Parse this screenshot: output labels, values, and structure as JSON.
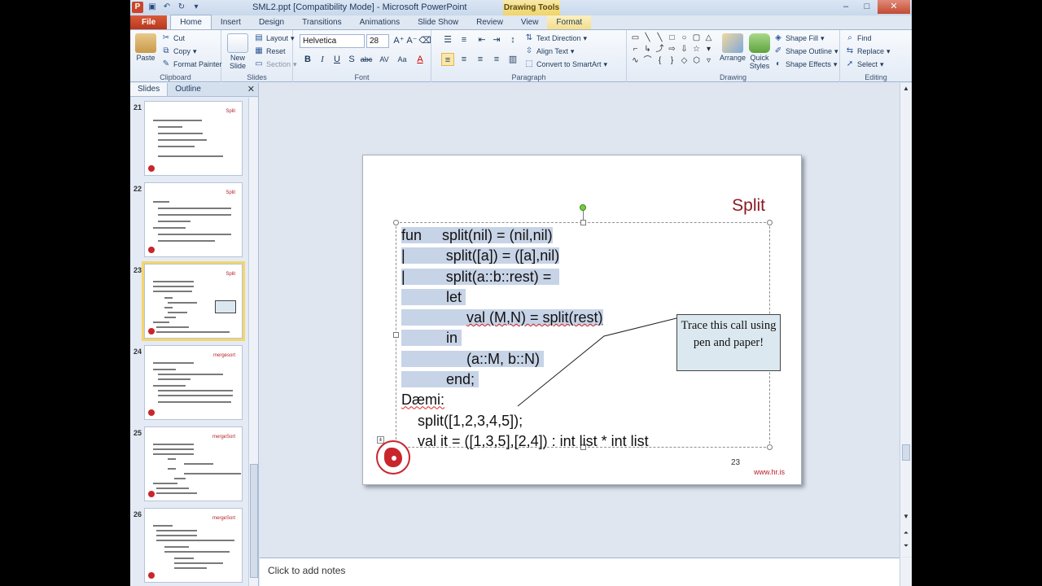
{
  "window": {
    "title": "SML2.ppt [Compatibility Mode] - Microsoft PowerPoint",
    "context_tab_label": "Drawing Tools"
  },
  "tabs": [
    "File",
    "Home",
    "Insert",
    "Design",
    "Transitions",
    "Animations",
    "Slide Show",
    "Review",
    "View",
    "Format"
  ],
  "ribbon": {
    "clipboard": {
      "paste": "Paste",
      "cut": "Cut",
      "copy": "Copy",
      "format_painter": "Format Painter",
      "label": "Clipboard"
    },
    "slides": {
      "new_slide": "New Slide",
      "layout": "Layout",
      "reset": "Reset",
      "section": "Section",
      "label": "Slides"
    },
    "font": {
      "name": "Helvetica",
      "size": "28",
      "label": "Font",
      "bold": "B",
      "italic": "I",
      "underline": "U",
      "strike": "S",
      "shadow": "abc",
      "spacing": "AV",
      "case": "Aa",
      "color": "A"
    },
    "paragraph": {
      "text_direction": "Text Direction",
      "align_text": "Align Text",
      "convert_smartart": "Convert to SmartArt",
      "label": "Paragraph"
    },
    "drawing": {
      "arrange": "Arrange",
      "quick_styles": "Quick Styles",
      "shape_fill": "Shape Fill",
      "shape_outline": "Shape Outline",
      "shape_effects": "Shape Effects",
      "label": "Drawing"
    },
    "editing": {
      "find": "Find",
      "replace": "Replace",
      "select": "Select",
      "label": "Editing"
    }
  },
  "left_panel": {
    "tabs": [
      "Slides",
      "Outline"
    ],
    "thumbnails": [
      {
        "num": "21",
        "title": "Split"
      },
      {
        "num": "22",
        "title": "Split"
      },
      {
        "num": "23",
        "title": "Split"
      },
      {
        "num": "24",
        "title": "mergesort"
      },
      {
        "num": "25",
        "title": "mergeSort"
      },
      {
        "num": "26",
        "title": "mergeSort"
      }
    ]
  },
  "slide": {
    "title": "Split",
    "code_lines": {
      "l1a": "fun",
      "l1b": "split(nil) = (nil,nil)",
      "l2a": "|",
      "l2b": "split([a]) = ([a],nil)",
      "l3a": "|",
      "l3b": "split(a::b::rest) =",
      "l4": "let",
      "l5": "val (M,N) = split(rest)",
      "l6": "in",
      "l7": "(a::M, b::N)",
      "l8": "end;",
      "l9": "Dæmi:",
      "l10": "split([1,2,3,4,5]);",
      "l11": "val it = ([1,3,5],[2,4]) : int list * int list"
    },
    "callout": "Trace this call using pen and paper!",
    "page_number": "23",
    "footer_link": "www.hr.is"
  },
  "notes": {
    "placeholder": "Click to add notes"
  }
}
